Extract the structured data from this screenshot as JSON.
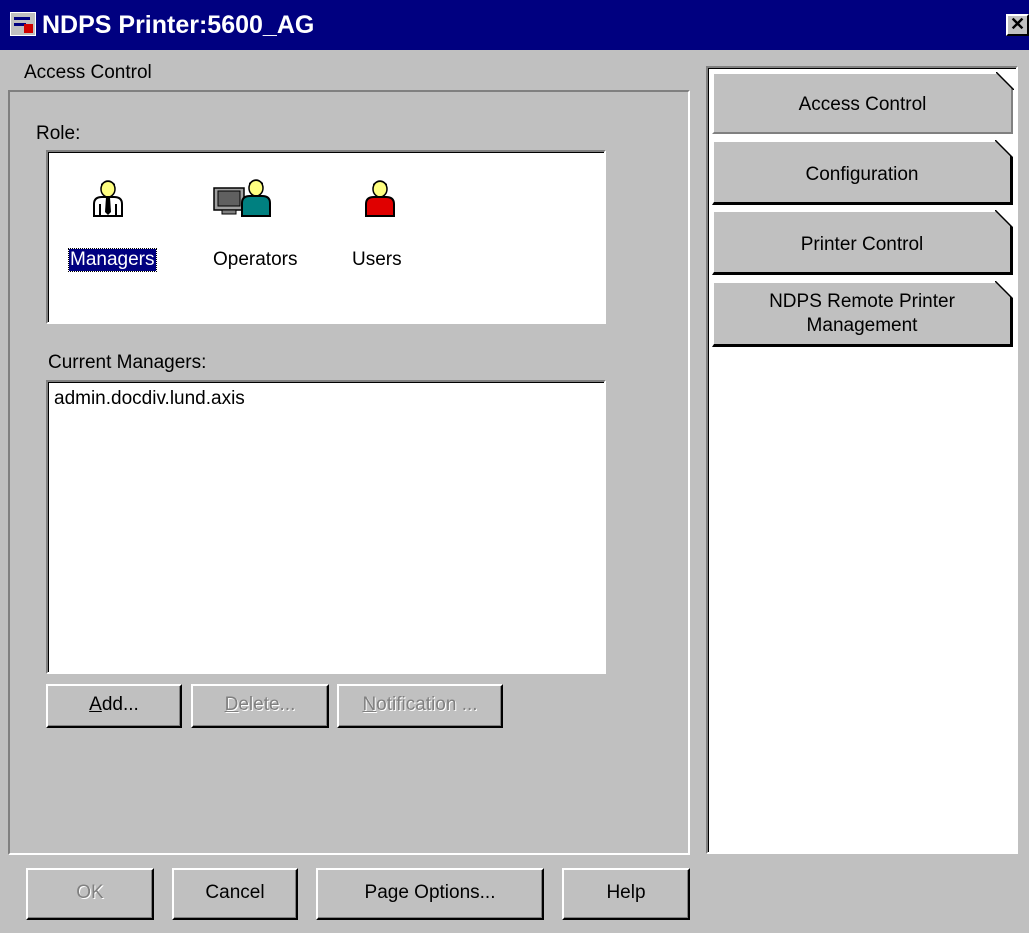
{
  "window": {
    "title": "NDPS Printer:5600_AG",
    "close_glyph": "✕"
  },
  "section_label": "Access Control",
  "role": {
    "label": "Role:",
    "items": [
      {
        "name": "Managers",
        "icon": "manager-person-icon",
        "selected": true
      },
      {
        "name": "Operators",
        "icon": "operator-computer-icon",
        "selected": false
      },
      {
        "name": "Users",
        "icon": "user-person-icon",
        "selected": false
      }
    ]
  },
  "current": {
    "label": "Current Managers:",
    "entries": [
      "admin.docdiv.lund.axis"
    ]
  },
  "actions": {
    "add": {
      "mnemonic": "A",
      "rest": "dd..."
    },
    "delete": {
      "mnemonic": "D",
      "rest": "elete..."
    },
    "notification": {
      "mnemonic": "N",
      "rest": "otification ..."
    }
  },
  "tabs": {
    "access_control": "Access Control",
    "configuration": "Configuration",
    "printer_control": "Printer Control",
    "remote_line1": "NDPS Remote Printer",
    "remote_line2": "Management"
  },
  "footer": {
    "ok": "OK",
    "cancel": "Cancel",
    "page_options": "Page Options...",
    "help": "Help"
  },
  "colors": {
    "titlebar": "#000080",
    "face": "#c0c0c0",
    "user_red": "#e00000",
    "operator_teal": "#008080"
  }
}
